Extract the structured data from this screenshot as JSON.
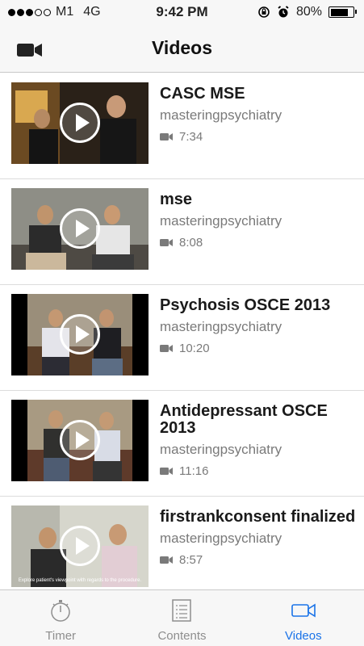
{
  "status_bar": {
    "carrier": "M1",
    "network": "4G",
    "time": "9:42 PM",
    "battery": "80%",
    "battery_level": 0.8
  },
  "nav": {
    "title": "Videos",
    "left_icon": "video-camera-icon"
  },
  "videos": [
    {
      "title": "CASC MSE",
      "channel": "masteringpsychiatry",
      "duration": "7:34"
    },
    {
      "title": "mse",
      "channel": "masteringpsychiatry",
      "duration": "8:08"
    },
    {
      "title": "Psychosis OSCE 2013",
      "channel": "masteringpsychiatry",
      "duration": "10:20"
    },
    {
      "title": "Antidepressant OSCE 2013",
      "channel": "masteringpsychiatry",
      "duration": "11:16"
    },
    {
      "title": "firstrankconsent finalized",
      "channel": "masteringpsychiatry",
      "duration": "8:57",
      "thumb_caption": "Explore patient's viewpoint with regards to the procedure."
    }
  ],
  "tabs": [
    {
      "label": "Timer",
      "icon": "stopwatch-icon",
      "active": false
    },
    {
      "label": "Contents",
      "icon": "list-icon",
      "active": false
    },
    {
      "label": "Videos",
      "icon": "video-camera-icon",
      "active": true
    }
  ],
  "colors": {
    "accent": "#1a73e8",
    "secondary_text": "#7a7a7a",
    "bar_background": "#f7f7f7"
  }
}
